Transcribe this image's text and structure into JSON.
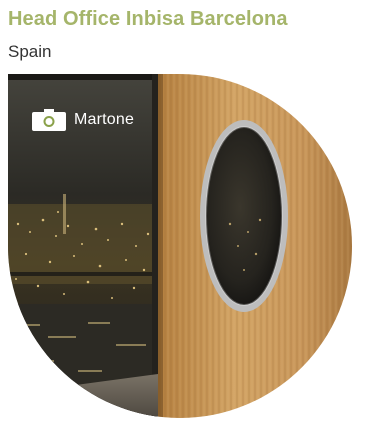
{
  "header": {
    "title": "Head Office Inbisa Barcelona",
    "subtitle": "Spain"
  },
  "photo": {
    "credit": "Martone",
    "credit_icon": "camera-icon"
  },
  "colors": {
    "accent": "#a5b56a",
    "wood": "#c89a55",
    "night_sky": "#2a2a26"
  }
}
